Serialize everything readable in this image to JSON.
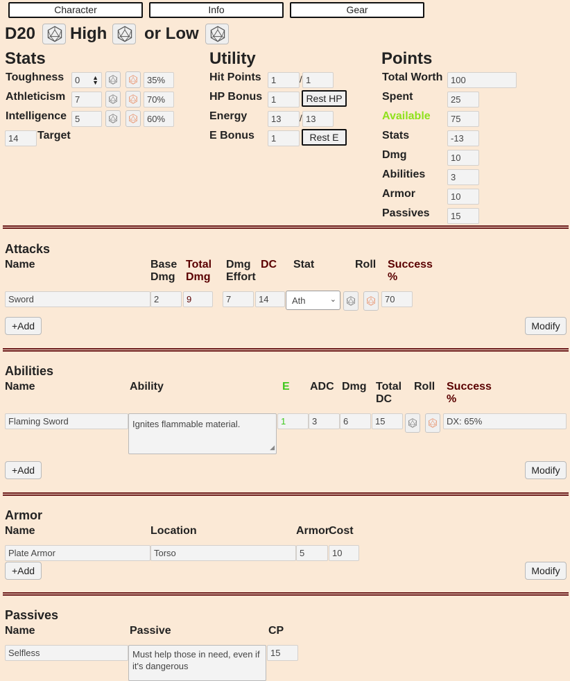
{
  "tabs": [
    "Character",
    "Info",
    "Gear"
  ],
  "roll_header": {
    "d20": "D20",
    "high": "High",
    "low": "or Low"
  },
  "stats": {
    "title": "Stats",
    "rows": [
      {
        "label": "Toughness",
        "value": "0",
        "pct": "35%"
      },
      {
        "label": "Athleticism",
        "value": "7",
        "pct": "70%"
      },
      {
        "label": "Intelligence",
        "value": "5",
        "pct": "60%"
      }
    ],
    "target_value": "14",
    "target_label": "Target"
  },
  "utility": {
    "title": "Utility",
    "hit_points": {
      "label": "Hit Points",
      "current": "1",
      "max": "1"
    },
    "hp_bonus": {
      "label": "HP Bonus",
      "value": "1",
      "button": "Rest HP"
    },
    "energy": {
      "label": "Energy",
      "current": "13",
      "max": "13"
    },
    "e_bonus": {
      "label": "E Bonus",
      "value": "1",
      "button": "Rest E"
    },
    "slash": "/"
  },
  "points": {
    "title": "Points",
    "rows": [
      {
        "label": "Total Worth",
        "value": "100"
      },
      {
        "label": "Spent",
        "value": "25"
      },
      {
        "label": "Available",
        "value": "75"
      },
      {
        "label": "Stats",
        "value": "-13"
      },
      {
        "label": "Dmg",
        "value": "10"
      },
      {
        "label": "Abilities",
        "value": "3"
      },
      {
        "label": "Armor",
        "value": "10"
      },
      {
        "label": "Passives",
        "value": "15"
      }
    ]
  },
  "attacks": {
    "title": "Attacks",
    "headers": {
      "name": "Name",
      "base1": "Base",
      "base2": "Dmg",
      "total1": "Total",
      "total2": "Dmg",
      "effort1": "Dmg",
      "effort2": "Effort",
      "dc": "DC",
      "stat": "Stat",
      "roll": "Roll",
      "success1": "Success",
      "success2": "%"
    },
    "row": {
      "name": "Sword",
      "base": "2",
      "total": "9",
      "effort": "7",
      "dc": "14",
      "stat": "Ath",
      "success": "70"
    },
    "add": "+Add",
    "modify": "Modify"
  },
  "abilities": {
    "title": "Abilities",
    "headers": {
      "name": "Name",
      "ability": "Ability",
      "e": "E",
      "adc": "ADC",
      "dmg": "Dmg",
      "total1": "Total",
      "total2": "DC",
      "roll": "Roll",
      "success1": "Success",
      "success2": "%"
    },
    "row": {
      "name": "Flaming Sword",
      "ability": "Ignites flammable material.",
      "e": "1",
      "adc": "3",
      "dmg": "6",
      "total": "15",
      "success": "DX: 65%"
    },
    "add": "+Add",
    "modify": "Modify"
  },
  "armor": {
    "title": "Armor",
    "headers": {
      "name": "Name",
      "location": "Location",
      "armor": "Armor",
      "cost": "Cost"
    },
    "row": {
      "name": "Plate Armor",
      "location": "Torso",
      "armor": "5",
      "cost": "10"
    },
    "add": "+Add",
    "modify": "Modify"
  },
  "passives": {
    "title": "Passives",
    "headers": {
      "name": "Name",
      "passive": "Passive",
      "cp": "CP"
    },
    "row": {
      "name": "Selfless",
      "passive": "Must help those in need, even if it's dangerous",
      "cp": "15"
    }
  },
  "colors": {
    "background": "#fbe9d6",
    "dark_red": "#5a0000",
    "green": "#3ec81d",
    "lime": "#8fe11c",
    "orange_die": "#e8916a"
  }
}
